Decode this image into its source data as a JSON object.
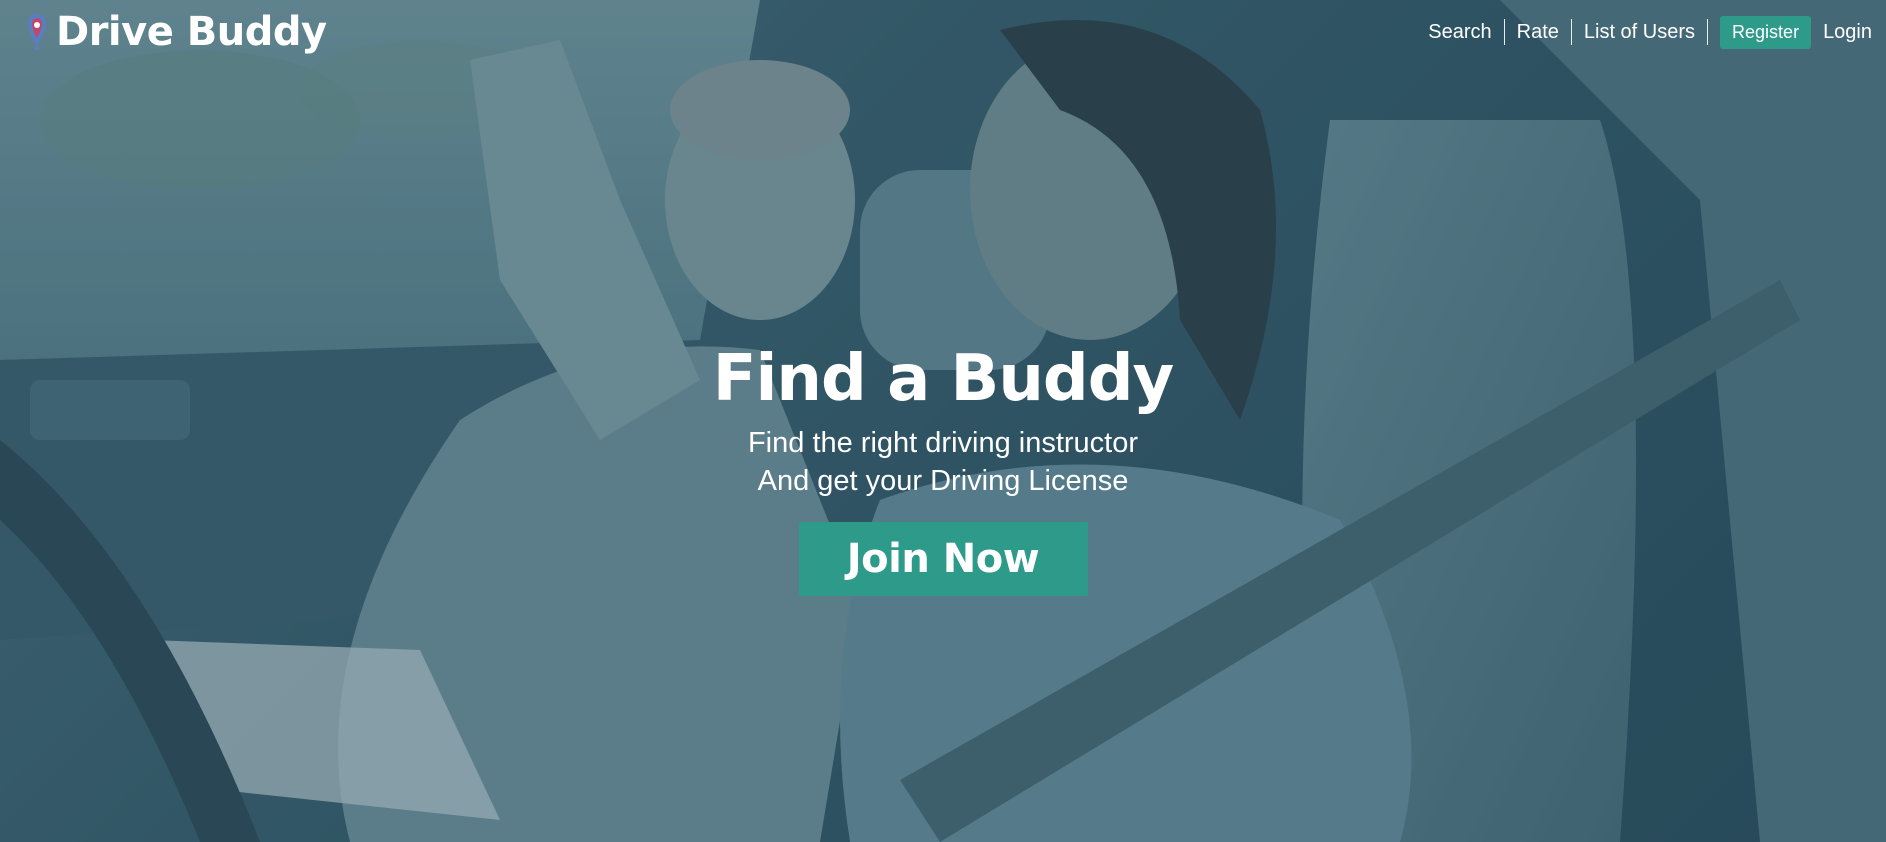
{
  "brand": {
    "name": "Drive Buddy",
    "logo_icon": "map-pin-icon"
  },
  "nav": {
    "search": "Search",
    "rate": "Rate",
    "list_of_users": "List of Users",
    "register": "Register",
    "login": "Login"
  },
  "hero": {
    "title": "Find a Buddy",
    "subtitle_line1": "Find the right driving instructor",
    "subtitle_line2": "And get your Driving License",
    "cta": "Join Now"
  },
  "colors": {
    "accent": "#2e9a8a",
    "overlay": "#2c4c5b"
  }
}
